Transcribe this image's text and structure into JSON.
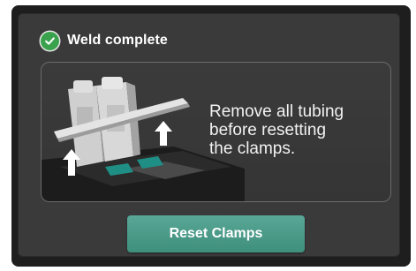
{
  "dialog": {
    "title": "Weld complete",
    "status_icon": "check-circle-icon",
    "status_color": "#3aa24d",
    "instruction": "Remove all tubing\nbefore resetting\nthe clamps.",
    "illustration": "welder-clamps-open-illustration",
    "reset_button_label": "Reset Clamps",
    "accent_color": "#4a9c8a"
  }
}
